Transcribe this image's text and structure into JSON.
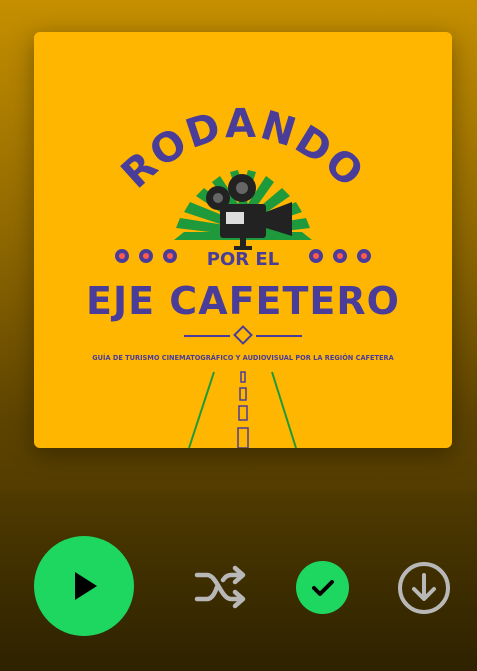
{
  "album": {
    "cover": {
      "title_top": "RODANDO",
      "title_middle": "POR EL",
      "title_main": "EJE CAFETERO",
      "subtitle": "GUÍA DE TURISMO CINEMATOGRÁFICO Y AUDIOVISUAL POR LA REGIÓN CAFETERA",
      "background_color": "#ffb600",
      "title_color": "#4a3d9a",
      "ray_color": "#1e9a3c"
    }
  },
  "controls": {
    "play": {
      "icon": "play-icon",
      "color": "#1ed760"
    },
    "shuffle": {
      "icon": "shuffle-icon",
      "color": "#b8b8b8"
    },
    "saved": {
      "icon": "check-icon",
      "state": "saved",
      "color": "#1ed760"
    },
    "download": {
      "icon": "download-circle-icon",
      "color": "#b8b8b8"
    }
  }
}
